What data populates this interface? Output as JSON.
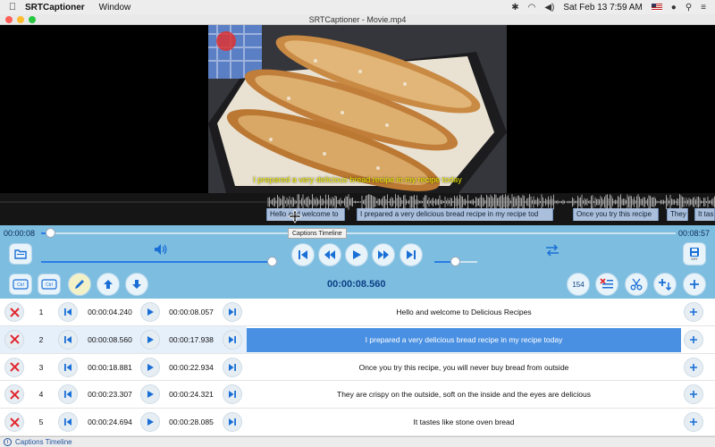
{
  "menubar": {
    "app_name": "SRTCaptioner",
    "menus": [
      "Window"
    ],
    "clock": "Sat Feb 13  7:59 AM"
  },
  "window": {
    "title": "SRTCaptioner - Movie.mp4"
  },
  "video": {
    "subtitle": "I prepared a very delicious bread recipe in my recipe today"
  },
  "timeline_captions": [
    "Hello and welcome to",
    "I prepared a very delicious bread recipe in my recipe tod",
    "Once you try this recipe",
    "They",
    "It tas"
  ],
  "player": {
    "elapsed": "00:00:08",
    "duration": "00:08:57",
    "progress": 0.016,
    "volume": 0.98,
    "speed": 0.5,
    "tooltip": "Captions Timeline",
    "current_time": "00:00:08.560",
    "caption_count": "154",
    "srt_label": "SRT",
    "ctrl_label_1": "Ctrl",
    "ctrl_label_2": "Ctrl"
  },
  "captions": [
    {
      "index": "1",
      "start": "00:00:04.240",
      "end": "00:00:08.057",
      "text": "Hello and welcome to Delicious Recipes"
    },
    {
      "index": "2",
      "start": "00:00:08.560",
      "end": "00:00:17.938",
      "text": "I prepared a very delicious bread recipe in my recipe today",
      "selected": true
    },
    {
      "index": "3",
      "start": "00:00:18.881",
      "end": "00:00:22.934",
      "text": "Once you try this recipe, you will never buy bread from outside"
    },
    {
      "index": "4",
      "start": "00:00:23.307",
      "end": "00:00:24.321",
      "text": "They are crispy on the outside, soft on the inside and the eyes are delicious"
    },
    {
      "index": "5",
      "start": "00:00:24.694",
      "end": "00:00:28.085",
      "text": "It tastes like stone oven bread"
    }
  ],
  "status": {
    "text": "Captions Timeline"
  },
  "colors": {
    "accent": "#1a6fd6",
    "panel": "#7dbde0",
    "selection": "#4a90e2",
    "subtitle": "#f4f000",
    "delete": "#e0282e"
  }
}
